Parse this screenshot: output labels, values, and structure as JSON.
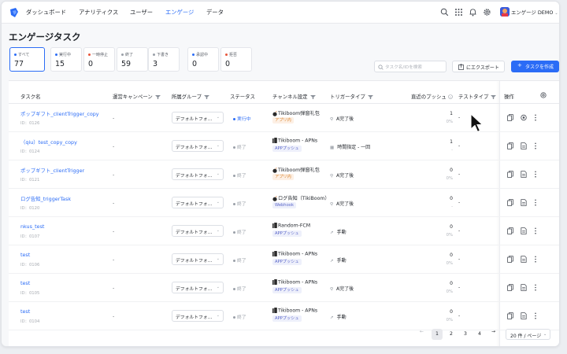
{
  "nav": {
    "items": [
      "ダッシュボード",
      "アナリティクス",
      "ユーザー",
      "エンゲージ",
      "データ"
    ],
    "active": "エンゲージ",
    "account": "エンゲージ DEMO"
  },
  "page": {
    "title": "エンゲージタスク"
  },
  "stats": [
    {
      "label": "すべて",
      "value": "77",
      "color": "#2b6cf6"
    },
    {
      "label": "実行中",
      "value": "15",
      "color": "#2b6cf6"
    },
    {
      "label": "一時停止",
      "value": "0",
      "color": "#e8553b"
    },
    {
      "label": "終了",
      "value": "59",
      "color": "#9aa0a8"
    },
    {
      "label": "下書き",
      "value": "3",
      "color": "#9aa0a8"
    },
    {
      "label": "承認中",
      "value": "0",
      "color": "#2b6cf6"
    },
    {
      "label": "拒否",
      "value": "0",
      "color": "#e8553b"
    }
  ],
  "toolbar": {
    "search_placeholder": "タスク名/IDを検索",
    "export_label": "にエクスポート",
    "create_label": "タスクを作成"
  },
  "columns": [
    "タスク名",
    "運営キャンペーン",
    "所属グループ",
    "ステータス",
    "チャンネル設定",
    "トリガータイプ",
    "直近のプッシュ",
    "テストタイプ",
    "操作"
  ],
  "rows": [
    {
      "name": "ポップギフト_clientTrigger_copy",
      "id": "ID：0126",
      "campaign": "-",
      "group": "デフォルトフォ…",
      "status": "実行中",
      "status_color": "#2b6cf6",
      "channel": "Tikiboom弾窗礼包",
      "channel_icon": "bomb",
      "channel_tag": "アプリ内",
      "tag_type": "in",
      "trigger_icon": "⚲",
      "trigger": "A完了後",
      "push": "1",
      "push_pct": "0%",
      "test": "-"
    },
    {
      "name": "（qiu）test_copy_copy",
      "id": "ID：0124",
      "campaign": "-",
      "group": "デフォルトフォ…",
      "status": "終了",
      "status_color": "#9aa0a8",
      "channel": "Tikiboom - APNs",
      "channel_icon": "apns",
      "channel_tag": "APPプッシュ",
      "tag_type": "app",
      "trigger_icon": "▦",
      "trigger": "時間指定 - 一回",
      "push": "1",
      "push_pct": "-",
      "test": "-"
    },
    {
      "name": "ポップギフト_clientTrigger",
      "id": "ID：0121",
      "campaign": "-",
      "group": "デフォルトフォ…",
      "status": "終了",
      "status_color": "#9aa0a8",
      "channel": "Tikiboom弾窗礼包",
      "channel_icon": "bomb",
      "channel_tag": "アプリ内",
      "tag_type": "in",
      "trigger_icon": "⚲",
      "trigger": "A完了後",
      "push": "0",
      "push_pct": "0%",
      "test": "-"
    },
    {
      "name": "ログ告知_triggerTask",
      "id": "ID：0120",
      "campaign": "-",
      "group": "デフォルトフォ…",
      "status": "終了",
      "status_color": "#9aa0a8",
      "channel": "ログ告知（TikiBoom）",
      "channel_icon": "bomb",
      "channel_tag": "Webhook",
      "tag_type": "web",
      "trigger_icon": "⚲",
      "trigger": "A完了後",
      "push": "0",
      "push_pct": "-",
      "test": "-"
    },
    {
      "name": "nkus_test",
      "id": "ID：0107",
      "campaign": "-",
      "group": "デフォルトフォ…",
      "status": "終了",
      "status_color": "#9aa0a8",
      "channel": "Random-FCM",
      "channel_icon": "apns",
      "channel_tag": "APPプッシュ",
      "tag_type": "app",
      "trigger_icon": "➚",
      "trigger": "手動",
      "push": "0",
      "push_pct": "0%",
      "test": "-"
    },
    {
      "name": "test",
      "id": "ID：0106",
      "campaign": "-",
      "group": "デフォルトフォ…",
      "status": "終了",
      "status_color": "#9aa0a8",
      "channel": "Tikiboom - APNs",
      "channel_icon": "apns",
      "channel_tag": "APPプッシュ",
      "tag_type": "app",
      "trigger_icon": "➚",
      "trigger": "手動",
      "push": "0",
      "push_pct": "0%",
      "test": "-"
    },
    {
      "name": "test",
      "id": "ID：0105",
      "campaign": "-",
      "group": "デフォルトフォ…",
      "status": "終了",
      "status_color": "#9aa0a8",
      "channel": "Tikiboom - APNs",
      "channel_icon": "apns",
      "channel_tag": "APPプッシュ",
      "tag_type": "app",
      "trigger_icon": "⚲",
      "trigger": "A完了後",
      "push": "0",
      "push_pct": "0%",
      "test": "-"
    },
    {
      "name": "test",
      "id": "ID：0104",
      "campaign": "-",
      "group": "デフォルトフォ…",
      "status": "終了",
      "status_color": "#9aa0a8",
      "channel": "Tikiboom - APNs",
      "channel_icon": "apns",
      "channel_tag": "APPプッシュ",
      "tag_type": "app",
      "trigger_icon": "➚",
      "trigger": "手動",
      "push": "0",
      "push_pct": "0%",
      "test": "-"
    }
  ],
  "pagination": {
    "pages": [
      "1",
      "2",
      "3",
      "4"
    ],
    "current": "1",
    "per_page": "20 件 / ページ"
  }
}
